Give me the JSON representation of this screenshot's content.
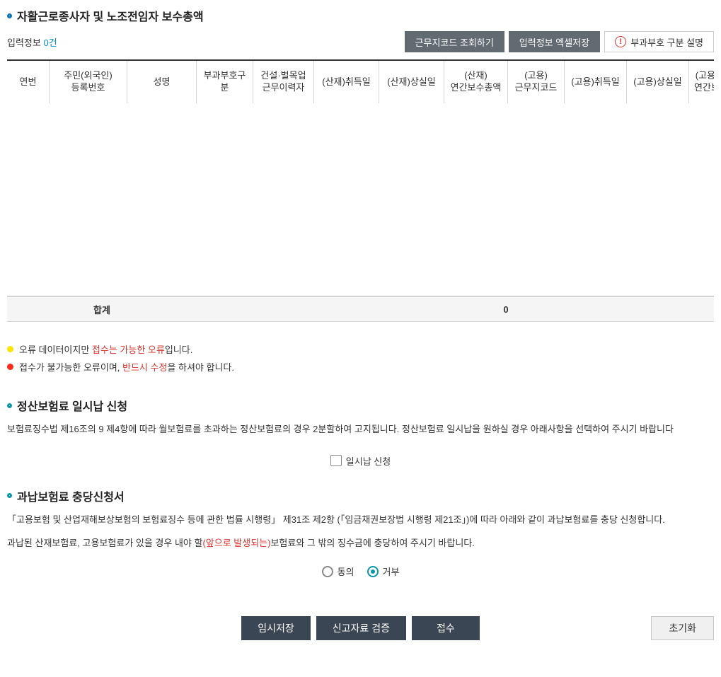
{
  "section1": {
    "title": "자활근로종사자 및 노조전임자 보수총액",
    "info_prefix": "입력정보",
    "info_count": "0건",
    "buttons": {
      "lookup": "근무지코드 조회하기",
      "excel": "입력정보 엑셀저장",
      "help": "부과부호 구분 설명"
    },
    "headers": [
      "연번",
      "주민(외국인)\n등록번호",
      "성명",
      "부과부호구분",
      "건설·벌목업\n근무이력자",
      "(산재)취득일",
      "(산재)상실일",
      "(산재)\n연간보수총액",
      "(고용)\n근무지코드",
      "(고용)취득일",
      "(고용)상실일",
      "(고용)\n연간보"
    ],
    "summary_label": "합계",
    "summary_value": "0"
  },
  "legend": {
    "row1_a": "오류 데이터이지만 ",
    "row1_b": "접수는 가능한 오류",
    "row1_c": "입니다.",
    "row2_a": "접수가 불가능한 오류이며, ",
    "row2_b": "반드시 수정",
    "row2_c": "을 하셔야 합니다."
  },
  "section2": {
    "title": "정산보험료 일시납 신청",
    "para": "보험료징수법 제16조의 9 제4항에 따라 월보험료를 초과하는 정산보험료의 경우 2분할하여 고지됩니다. 정산보험료 일시납을 원하실 경우 아래사항을 선택하여 주시기 바랍니다",
    "checkbox_label": "일시납 신청"
  },
  "section3": {
    "title": "과납보험료 충당신청서",
    "para1": "「고용보험 및 산업재해보상보험의 보험료징수 등에 관한 법률 시행령」 제31조 제2항 (「임금채권보장법 시행령 제21조」)에 따라 아래와 같이 과납보험료를 충당 신청합니다.",
    "para2_a": "과납된 산재보험료, 고용보험료가 있을 경우 내야 할",
    "para2_b": "(앞으로 발생되는)",
    "para2_c": "보험료와 그 밖의 징수금에 충당하여 주시기 바랍니다.",
    "radio_agree": "동의",
    "radio_reject": "거부"
  },
  "actions": {
    "temp_save": "임시저장",
    "validate": "신고자료 검증",
    "submit": "접수",
    "reset": "초기화"
  },
  "chart_data": {
    "type": "table",
    "title": "자활근로종사자 및 노조전임자 보수총액",
    "columns": [
      "연번",
      "주민(외국인)등록번호",
      "성명",
      "부과부호구분",
      "건설·벌목업 근무이력자",
      "(산재)취득일",
      "(산재)상실일",
      "(산재)연간보수총액",
      "(고용)근무지코드",
      "(고용)취득일",
      "(고용)상실일",
      "(고용)연간보수총액"
    ],
    "rows": [],
    "summary": {
      "label": "합계",
      "(산재)연간보수총액": 0
    }
  }
}
